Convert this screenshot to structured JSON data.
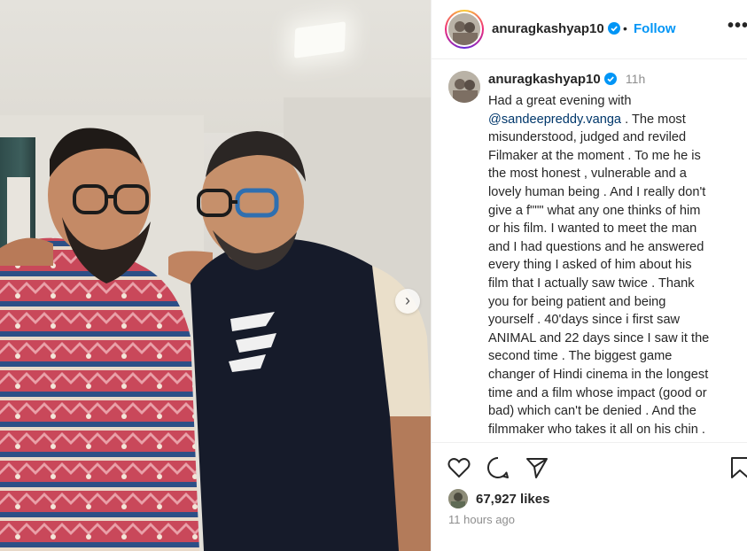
{
  "header": {
    "username": "anuragkashyap10",
    "separator": "•",
    "follow_label": "Follow",
    "more_label": "•••",
    "verified_icon": "verified-badge-icon",
    "verified_color": "#0095f6"
  },
  "caption": {
    "username": "anuragkashyap10",
    "time": "11h",
    "lines": [
      "Had a great evening with",
      "@sandeepreddy.vanga",
      "misunderstood, judged and reviled",
      "Filmaker at the moment . To me he is",
      "the most honest , vulnerable and a",
      "lovely human being . And I really don't",
      "give a f\"\"\" what any one thinks of him",
      "or his film. I wanted to meet the man",
      "and I had questions and he answered",
      "every thing I asked of him about his",
      "film that I actually saw twice . Thank",
      "you for being patient and being",
      "yourself . 40'days since i first saw",
      "ANIMAL and 22 days since I saw it the",
      "second time . The biggest game",
      "changer of Hindi cinema in the longest",
      "time and a film whose impact (good or",
      "bad) which can't be denied . And the",
      "filmmaker who takes it all on his chin ."
    ],
    "mention_suffix": " . The most",
    "mention_color": "#00376b"
  },
  "actions": {
    "like_icon": "heart-icon",
    "comment_icon": "comment-icon",
    "share_icon": "share-icon",
    "save_icon": "bookmark-icon",
    "likes": "67,927 likes",
    "time_ago": "11 hours ago"
  },
  "photo": {
    "next_label": "›",
    "next_icon": "chevron-right-icon"
  },
  "colors": {
    "accent": "#0095f6",
    "text": "#262626",
    "muted": "#8e8e8e"
  }
}
